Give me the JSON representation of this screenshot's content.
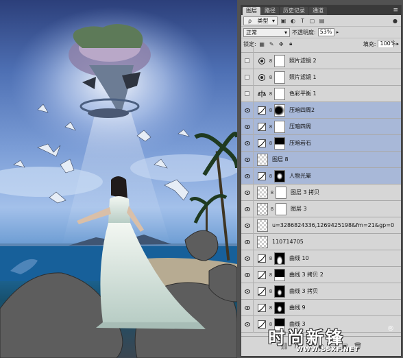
{
  "panel": {
    "tabs": [
      "图层",
      "路径",
      "历史记录",
      "通道"
    ],
    "filter_kind": "类型",
    "blend_mode": "正常",
    "opacity_label": "不透明度:",
    "opacity_value": "53%",
    "lock_label": "锁定:",
    "fill_label": "填充:",
    "fill_value": "100%"
  },
  "layers": [
    {
      "name": "照片滤镜 2",
      "visible": false,
      "kind": "adjustment",
      "icon": "photo-filter-icon",
      "selected": false
    },
    {
      "name": "照片滤镜 1",
      "visible": false,
      "kind": "adjustment",
      "icon": "photo-filter-icon",
      "selected": false
    },
    {
      "name": "色彩平衡 1",
      "visible": false,
      "kind": "adjustment",
      "icon": "color-balance-icon",
      "selected": false
    },
    {
      "name": "压暗四周2",
      "visible": true,
      "kind": "curves",
      "selected": true
    },
    {
      "name": "压暗四周",
      "visible": true,
      "kind": "curves",
      "selected": true
    },
    {
      "name": "压暗岩石",
      "visible": true,
      "kind": "curves",
      "selected": true
    },
    {
      "name": "图层 8",
      "visible": true,
      "kind": "pixel",
      "selected": true
    },
    {
      "name": "人物光晕",
      "visible": true,
      "kind": "curves",
      "selected": true
    },
    {
      "name": "图层 3 拷贝",
      "visible": true,
      "kind": "pixel-mask",
      "selected": false
    },
    {
      "name": "图层 3",
      "visible": true,
      "kind": "pixel-mask",
      "selected": false
    },
    {
      "name": "u=3286824336,1269425198&fm=21&gp=0",
      "visible": true,
      "kind": "pixel",
      "selected": false
    },
    {
      "name": "110714705",
      "visible": true,
      "kind": "pixel",
      "selected": false
    },
    {
      "name": "曲线 10",
      "visible": true,
      "kind": "curves",
      "selected": false
    },
    {
      "name": "曲线 3 拷贝 2",
      "visible": true,
      "kind": "curves",
      "selected": false
    },
    {
      "name": "曲线 3 拷贝",
      "visible": true,
      "kind": "curves",
      "selected": false
    },
    {
      "name": "曲线 9",
      "visible": true,
      "kind": "curves",
      "selected": false
    },
    {
      "name": "曲线 3",
      "visible": true,
      "kind": "curves",
      "selected": false
    }
  ],
  "watermark": {
    "title": "时尚新锋",
    "url": "WWW.SSXF.NET",
    "reg": "®"
  }
}
